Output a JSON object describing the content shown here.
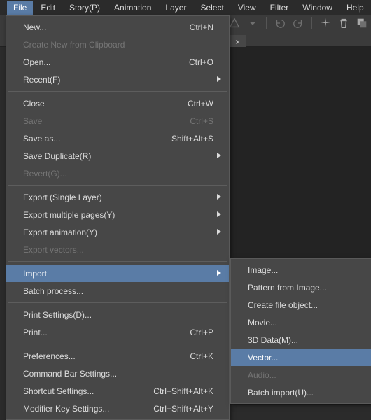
{
  "menubar": {
    "items": [
      {
        "label": "File",
        "active": true
      },
      {
        "label": "Edit"
      },
      {
        "label": "Story(P)"
      },
      {
        "label": "Animation"
      },
      {
        "label": "Layer"
      },
      {
        "label": "Select"
      },
      {
        "label": "View"
      },
      {
        "label": "Filter"
      },
      {
        "label": "Window"
      },
      {
        "label": "Help"
      }
    ]
  },
  "doc_tab": {
    "close_glyph": "×"
  },
  "file_menu": {
    "items": [
      {
        "type": "item",
        "label": "New...",
        "shortcut": "Ctrl+N"
      },
      {
        "type": "item",
        "label": "Create New from Clipboard",
        "disabled": true
      },
      {
        "type": "item",
        "label": "Open...",
        "shortcut": "Ctrl+O"
      },
      {
        "type": "item",
        "label": "Recent(F)",
        "submenu": true
      },
      {
        "type": "sep"
      },
      {
        "type": "item",
        "label": "Close",
        "shortcut": "Ctrl+W"
      },
      {
        "type": "item",
        "label": "Save",
        "shortcut": "Ctrl+S",
        "disabled": true
      },
      {
        "type": "item",
        "label": "Save as...",
        "shortcut": "Shift+Alt+S"
      },
      {
        "type": "item",
        "label": "Save Duplicate(R)",
        "submenu": true
      },
      {
        "type": "item",
        "label": "Revert(G)...",
        "disabled": true
      },
      {
        "type": "sep"
      },
      {
        "type": "item",
        "label": "Export (Single Layer)",
        "submenu": true
      },
      {
        "type": "item",
        "label": "Export multiple pages(Y)",
        "submenu": true
      },
      {
        "type": "item",
        "label": "Export animation(Y)",
        "submenu": true
      },
      {
        "type": "item",
        "label": "Export vectors...",
        "disabled": true
      },
      {
        "type": "sep"
      },
      {
        "type": "item",
        "label": "Import",
        "submenu": true,
        "hovered": true
      },
      {
        "type": "item",
        "label": "Batch process..."
      },
      {
        "type": "sep"
      },
      {
        "type": "item",
        "label": "Print Settings(D)..."
      },
      {
        "type": "item",
        "label": "Print...",
        "shortcut": "Ctrl+P"
      },
      {
        "type": "sep"
      },
      {
        "type": "item",
        "label": "Preferences...",
        "shortcut": "Ctrl+K"
      },
      {
        "type": "item",
        "label": "Command Bar Settings..."
      },
      {
        "type": "item",
        "label": "Shortcut Settings...",
        "shortcut": "Ctrl+Shift+Alt+K"
      },
      {
        "type": "item",
        "label": "Modifier Key Settings...",
        "shortcut": "Ctrl+Shift+Alt+Y"
      }
    ]
  },
  "import_menu": {
    "items": [
      {
        "type": "item",
        "label": "Image..."
      },
      {
        "type": "item",
        "label": "Pattern from Image..."
      },
      {
        "type": "item",
        "label": "Create file object..."
      },
      {
        "type": "item",
        "label": "Movie..."
      },
      {
        "type": "item",
        "label": "3D Data(M)..."
      },
      {
        "type": "item",
        "label": "Vector...",
        "hovered": true
      },
      {
        "type": "item",
        "label": "Audio...",
        "disabled": true
      },
      {
        "type": "item",
        "label": "Batch import(U)..."
      }
    ]
  }
}
